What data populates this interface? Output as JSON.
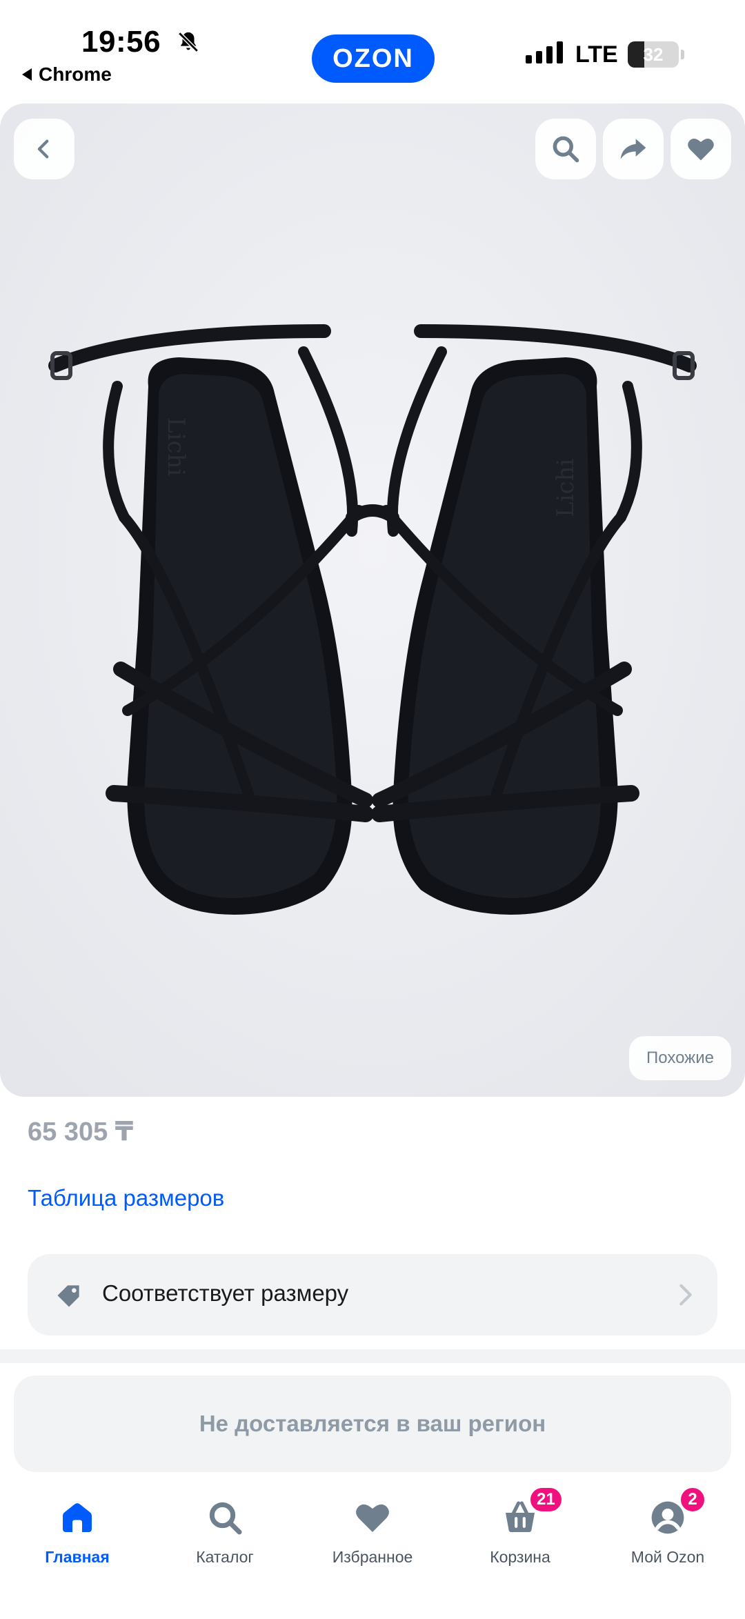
{
  "status_bar": {
    "time": "19:56",
    "back_app": "Chrome",
    "brand": "OZON",
    "network": "LTE",
    "battery": "32"
  },
  "product": {
    "price": "65 305 ₸",
    "size_table_link": "Таблица размеров",
    "fit_label": "Соответствует размеру",
    "similar_button": "Похожие",
    "delivery_notice": "Не доставляется в ваш регион",
    "insole_brand": "Lichi"
  },
  "bottom_nav": {
    "items": [
      {
        "label": "Главная",
        "icon": "home-icon",
        "active": true
      },
      {
        "label": "Каталог",
        "icon": "search-icon"
      },
      {
        "label": "Избранное",
        "icon": "heart-icon"
      },
      {
        "label": "Корзина",
        "icon": "cart-icon",
        "badge": "21"
      },
      {
        "label": "Мой Ozon",
        "icon": "profile-icon",
        "badge": "2"
      }
    ]
  },
  "colors": {
    "accent": "#005bff",
    "badge": "#f1117e",
    "muted_text": "#9da4ad",
    "card_bg": "#f2f3f5"
  }
}
